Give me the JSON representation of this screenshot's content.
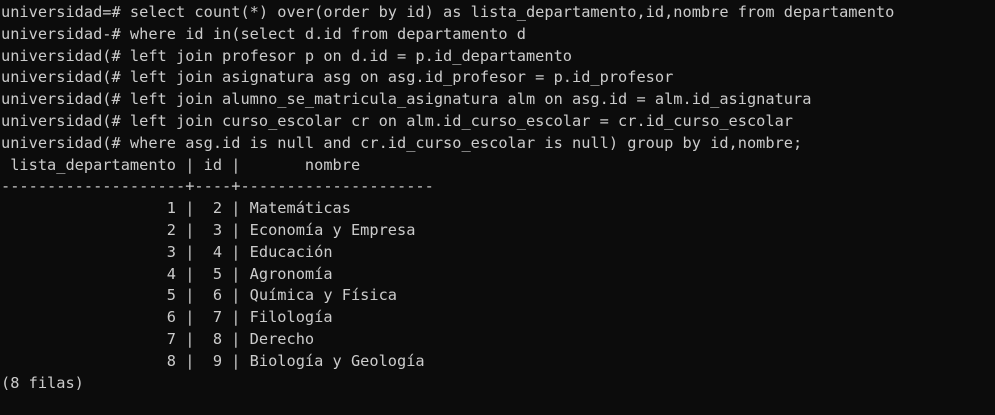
{
  "terminal": {
    "colors": {
      "background": "#0c0c0c",
      "foreground": "#cccccc"
    },
    "query_lines": [
      "universidad=# select count(*) over(order by id) as lista_departamento,id,nombre from departamento",
      "universidad-# where id in(select d.id from departamento d",
      "universidad(# left join profesor p on d.id = p.id_departamento",
      "universidad(# left join asignatura asg on asg.id_profesor = p.id_profesor",
      "universidad(# left join alumno_se_matricula_asignatura alm on asg.id = alm.id_asignatura",
      "universidad(# left join curso_escolar cr on alm.id_curso_escolar = cr.id_curso_escolar",
      "universidad(# where asg.id is null and cr.id_curso_escolar is null) group by id,nombre;"
    ],
    "result_header": " lista_departamento | id |       nombre",
    "result_separator": "--------------------+----+---------------------",
    "result_rows": [
      "                  1 |  2 | Matemáticas",
      "                  2 |  3 | Economía y Empresa",
      "                  3 |  4 | Educación",
      "                  4 |  5 | Agronomía",
      "                  5 |  6 | Química y Física",
      "                  6 |  7 | Filología",
      "                  7 |  8 | Derecho",
      "                  8 |  9 | Biología y Geología"
    ],
    "row_count": "(8 filas)"
  }
}
